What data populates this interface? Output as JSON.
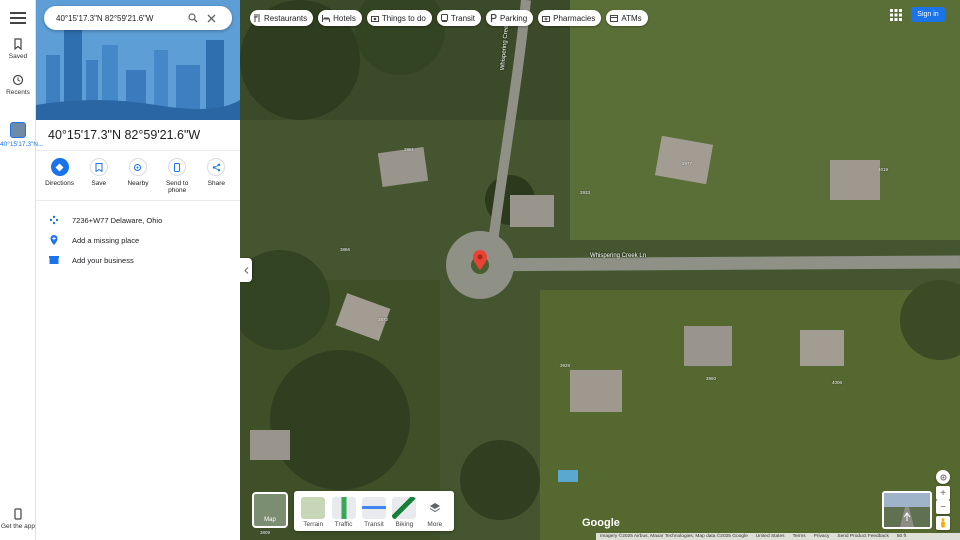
{
  "rail": {
    "saved": "Saved",
    "recents": "Recents",
    "current": "40°15'17.3\"N...",
    "get_app": "Get the app"
  },
  "search": {
    "value": "40°15'17.3\"N 82°59'21.6\"W"
  },
  "place": {
    "title": "40°15'17.3\"N 82°59'21.6\"W",
    "actions": [
      {
        "label": "Directions",
        "icon": "directions-icon"
      },
      {
        "label": "Save",
        "icon": "bookmark-icon"
      },
      {
        "label": "Nearby",
        "icon": "nearby-icon"
      },
      {
        "label": "Send to phone",
        "icon": "phone-icon"
      },
      {
        "label": "Share",
        "icon": "share-icon"
      }
    ],
    "plus_code": "7236+W77 Delaware, Ohio",
    "add_missing_place": "Add a missing place",
    "add_business": "Add your business"
  },
  "chips": [
    {
      "label": "Restaurants",
      "icon": "restaurant-icon"
    },
    {
      "label": "Hotels",
      "icon": "hotel-icon"
    },
    {
      "label": "Things to do",
      "icon": "camera-icon"
    },
    {
      "label": "Transit",
      "icon": "transit-icon"
    },
    {
      "label": "Parking",
      "icon": "parking-icon"
    },
    {
      "label": "Pharmacies",
      "icon": "pharmacy-icon"
    },
    {
      "label": "ATMs",
      "icon": "atm-icon"
    }
  ],
  "header": {
    "sign_in": "Sign in"
  },
  "layers": {
    "current": "Map",
    "options": [
      "Terrain",
      "Traffic",
      "Transit",
      "Biking",
      "More"
    ]
  },
  "map": {
    "road_main": "Whispering Creek Ln",
    "road_vertical": "Whispering Creek Ln",
    "house_numbers": [
      "3881",
      "3977",
      "4019",
      "3866",
      "3933",
      "3872",
      "3928",
      "3960",
      "4006",
      "3809"
    ],
    "brand": "Google"
  },
  "footer": {
    "imagery": "Imagery ©2025 Airbus, Maxar Technologies, Map data ©2025 Google",
    "country": "United States",
    "terms": "Terms",
    "privacy": "Privacy",
    "feedback": "Send Product Feedback",
    "scale": "50 ft"
  },
  "colors": {
    "accent": "#1a73e8",
    "pin": "#ea4335"
  }
}
